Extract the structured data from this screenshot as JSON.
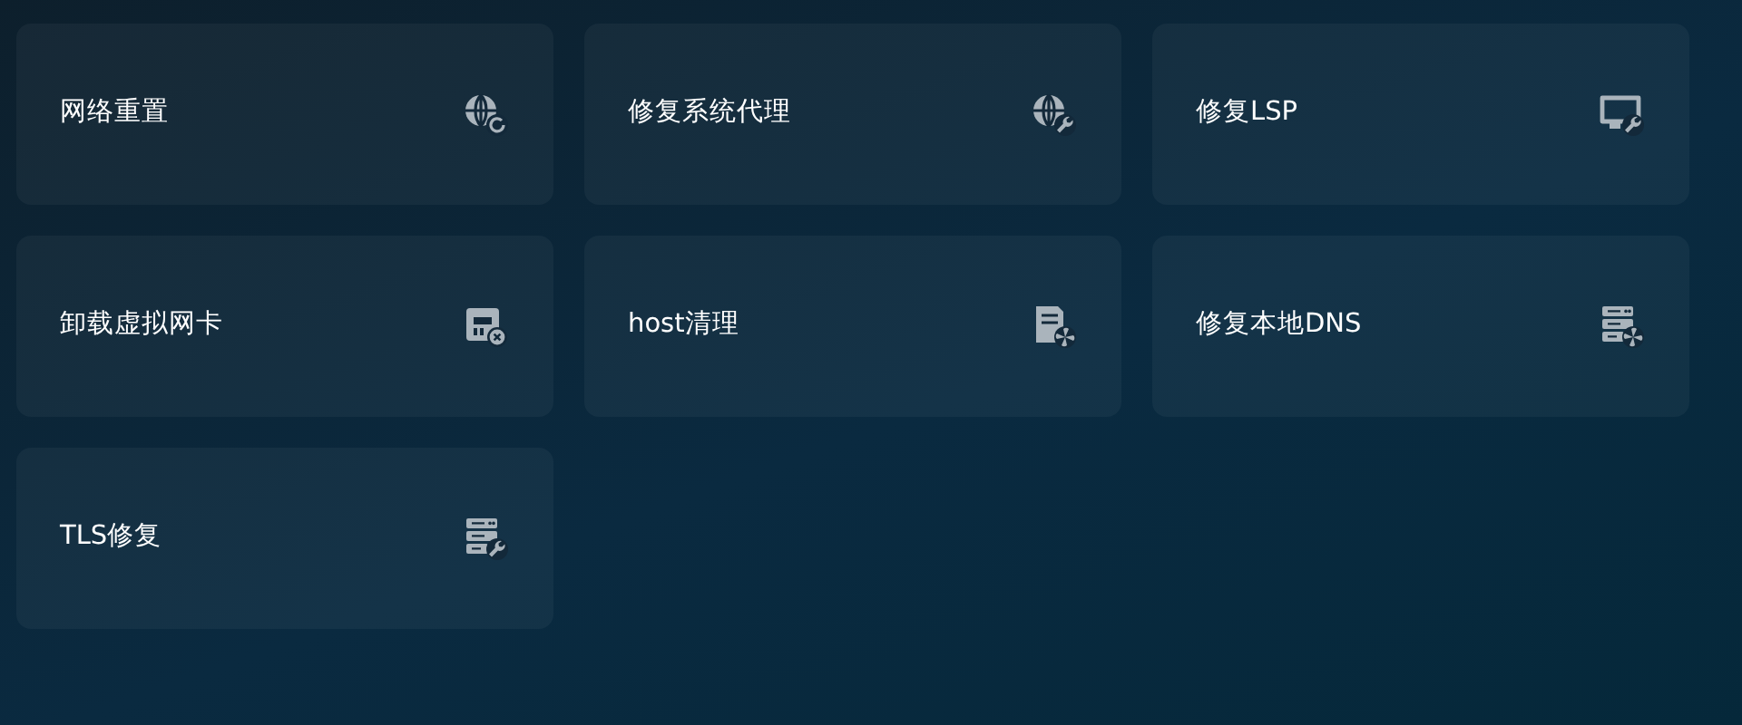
{
  "tools": [
    {
      "label": "网络重置"
    },
    {
      "label": "修复系统代理"
    },
    {
      "label": "修复LSP"
    },
    {
      "label": "卸载虚拟网卡"
    },
    {
      "label": "host清理"
    },
    {
      "label": "修复本地DNS"
    },
    {
      "label": "TLS修复"
    }
  ]
}
